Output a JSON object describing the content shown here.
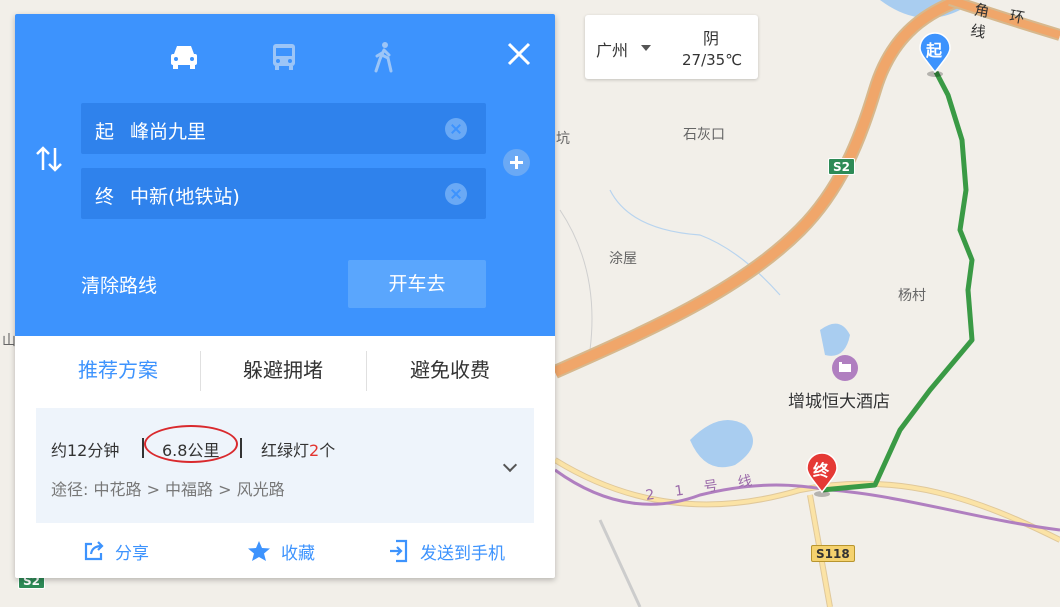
{
  "map": {
    "labels": {
      "shihuikou": "石灰口",
      "tuwu": "涂屋",
      "yangcun": "杨村",
      "hotel": "增城恒大酒店",
      "kang": "坑",
      "shan": "山",
      "ring_road": "角 环 线",
      "metro_line": "2 1 号 线"
    },
    "shields": {
      "s2_top": "S2",
      "s118": "S118",
      "s2_bottom": "S2"
    },
    "markers": {
      "start": "起",
      "end": "终"
    },
    "colors": {
      "route": "#3a9a45",
      "expressway": "#f0a66a",
      "metro": "#b07fc0"
    }
  },
  "weather": {
    "city": "广州",
    "condition": "阴",
    "temperature": "27/35℃"
  },
  "panel": {
    "modes": [
      {
        "name": "car-icon",
        "active": true
      },
      {
        "name": "bus-icon",
        "active": false
      },
      {
        "name": "walk-icon",
        "active": false
      }
    ],
    "start": {
      "prefix": "起",
      "value": "峰尚九里"
    },
    "end": {
      "prefix": "终",
      "value": "中新(地铁站)"
    },
    "clear_route_label": "清除路线",
    "drive_label": "开车去",
    "tabs": [
      {
        "label": "推荐方案",
        "active": true
      },
      {
        "label": "躲避拥堵",
        "active": false
      },
      {
        "label": "避免收费",
        "active": false
      }
    ],
    "route": {
      "time": "约12分钟",
      "distance": "6.8公里",
      "lights_prefix": "红绿灯",
      "lights_count": "2",
      "lights_suffix": "个",
      "via": "途径:  中花路 > 中福路 > 风光路"
    },
    "actions": {
      "share": "分享",
      "favorite": "收藏",
      "send": "发送到手机"
    }
  }
}
